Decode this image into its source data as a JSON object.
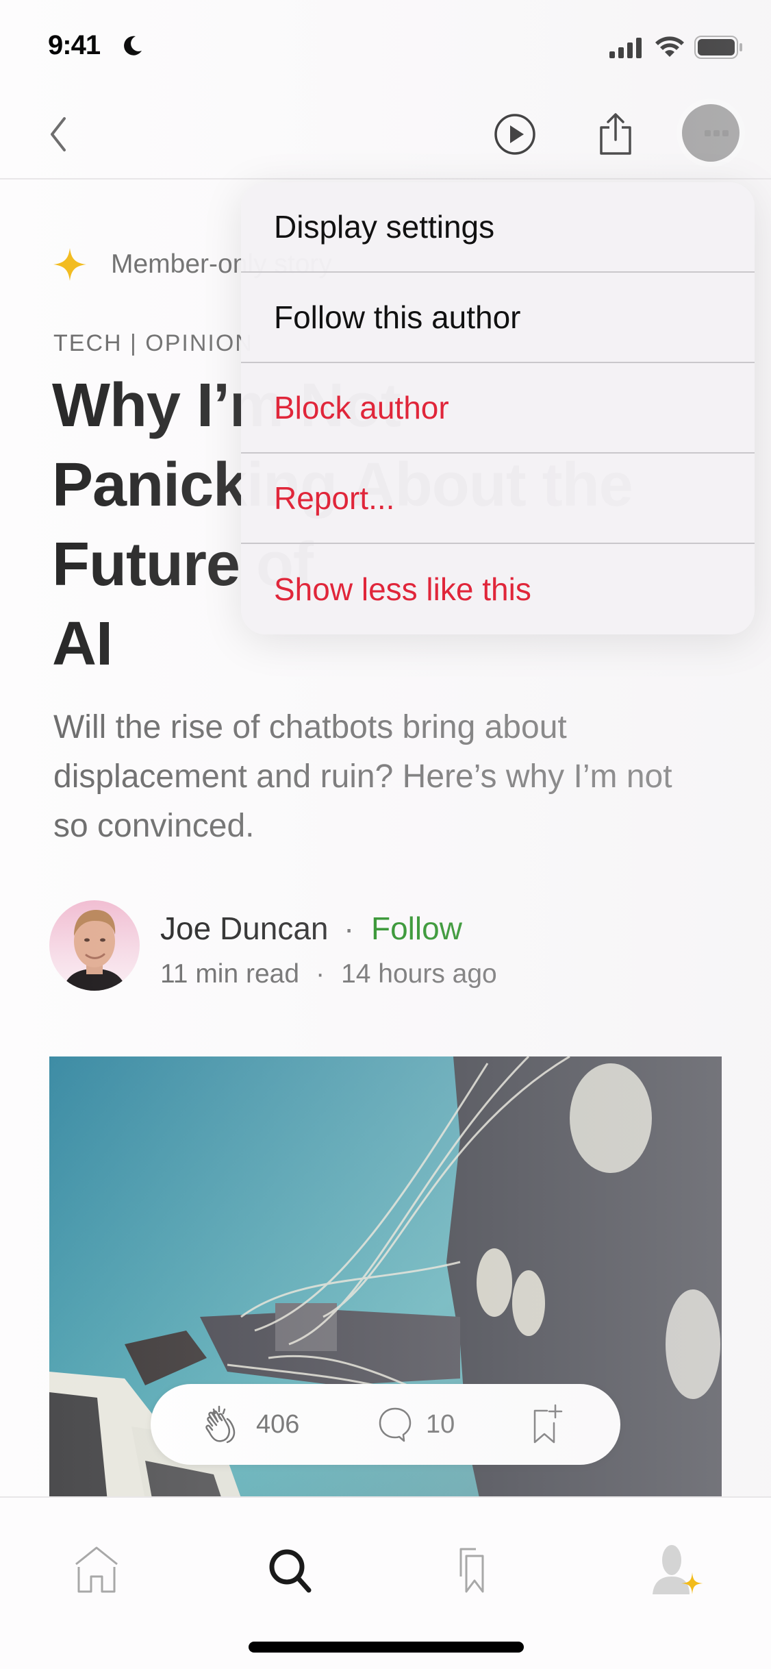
{
  "status_bar": {
    "time": "9:41",
    "focus_icon": "moon-icon",
    "signal_icon": "cellular-signal-icon",
    "wifi_icon": "wifi-icon",
    "battery_icon": "battery-icon"
  },
  "nav_bar": {
    "back_icon": "chevron-left-icon",
    "listen_icon": "play-circle-icon",
    "share_icon": "share-icon",
    "more_icon": "more-horizontal-icon"
  },
  "article": {
    "member_badge": "Member-only story",
    "kicker": "TECH | OPINION",
    "title": "Why I’m Not Panicking About the Future of AI",
    "title_lines": [
      "Why I’m Not",
      "Panicking About the",
      "Future of",
      "AI"
    ],
    "subtitle": "Will the rise of chatbots bring about displacement and ruin? Here’s why I’m not so convinced.",
    "author": {
      "name": "Joe Duncan",
      "separator": "·",
      "follow_label": "Follow",
      "read_time": "11 min read",
      "meta_separator": "·",
      "published": "14 hours ago"
    },
    "hero_image_alt": "Robot arm with wires reaching toward a keyboard"
  },
  "actions": {
    "claps": "406",
    "responses": "10",
    "clap_icon": "clap-icon",
    "response_icon": "speech-bubble-icon",
    "save_icon": "bookmark-add-icon"
  },
  "context_menu": {
    "items": [
      {
        "label": "Display settings",
        "style": "default"
      },
      {
        "label": "Follow this author",
        "style": "default"
      },
      {
        "label": "Block author",
        "style": "destructive"
      },
      {
        "label": "Report...",
        "style": "destructive"
      },
      {
        "label": "Show less like this",
        "style": "destructive"
      }
    ]
  },
  "tab_bar": {
    "tabs": [
      {
        "name": "home",
        "icon": "home-icon",
        "active": false
      },
      {
        "name": "search",
        "icon": "search-icon",
        "active": true
      },
      {
        "name": "library",
        "icon": "bookmarks-icon",
        "active": false
      },
      {
        "name": "profile",
        "icon": "profile-icon",
        "active": false
      }
    ]
  },
  "colors": {
    "accent_green": "#1a8917",
    "destructive_red": "#e0263a",
    "member_gold": "#f2bb1b",
    "text_primary": "#242424",
    "text_secondary": "#6b6b6b"
  }
}
